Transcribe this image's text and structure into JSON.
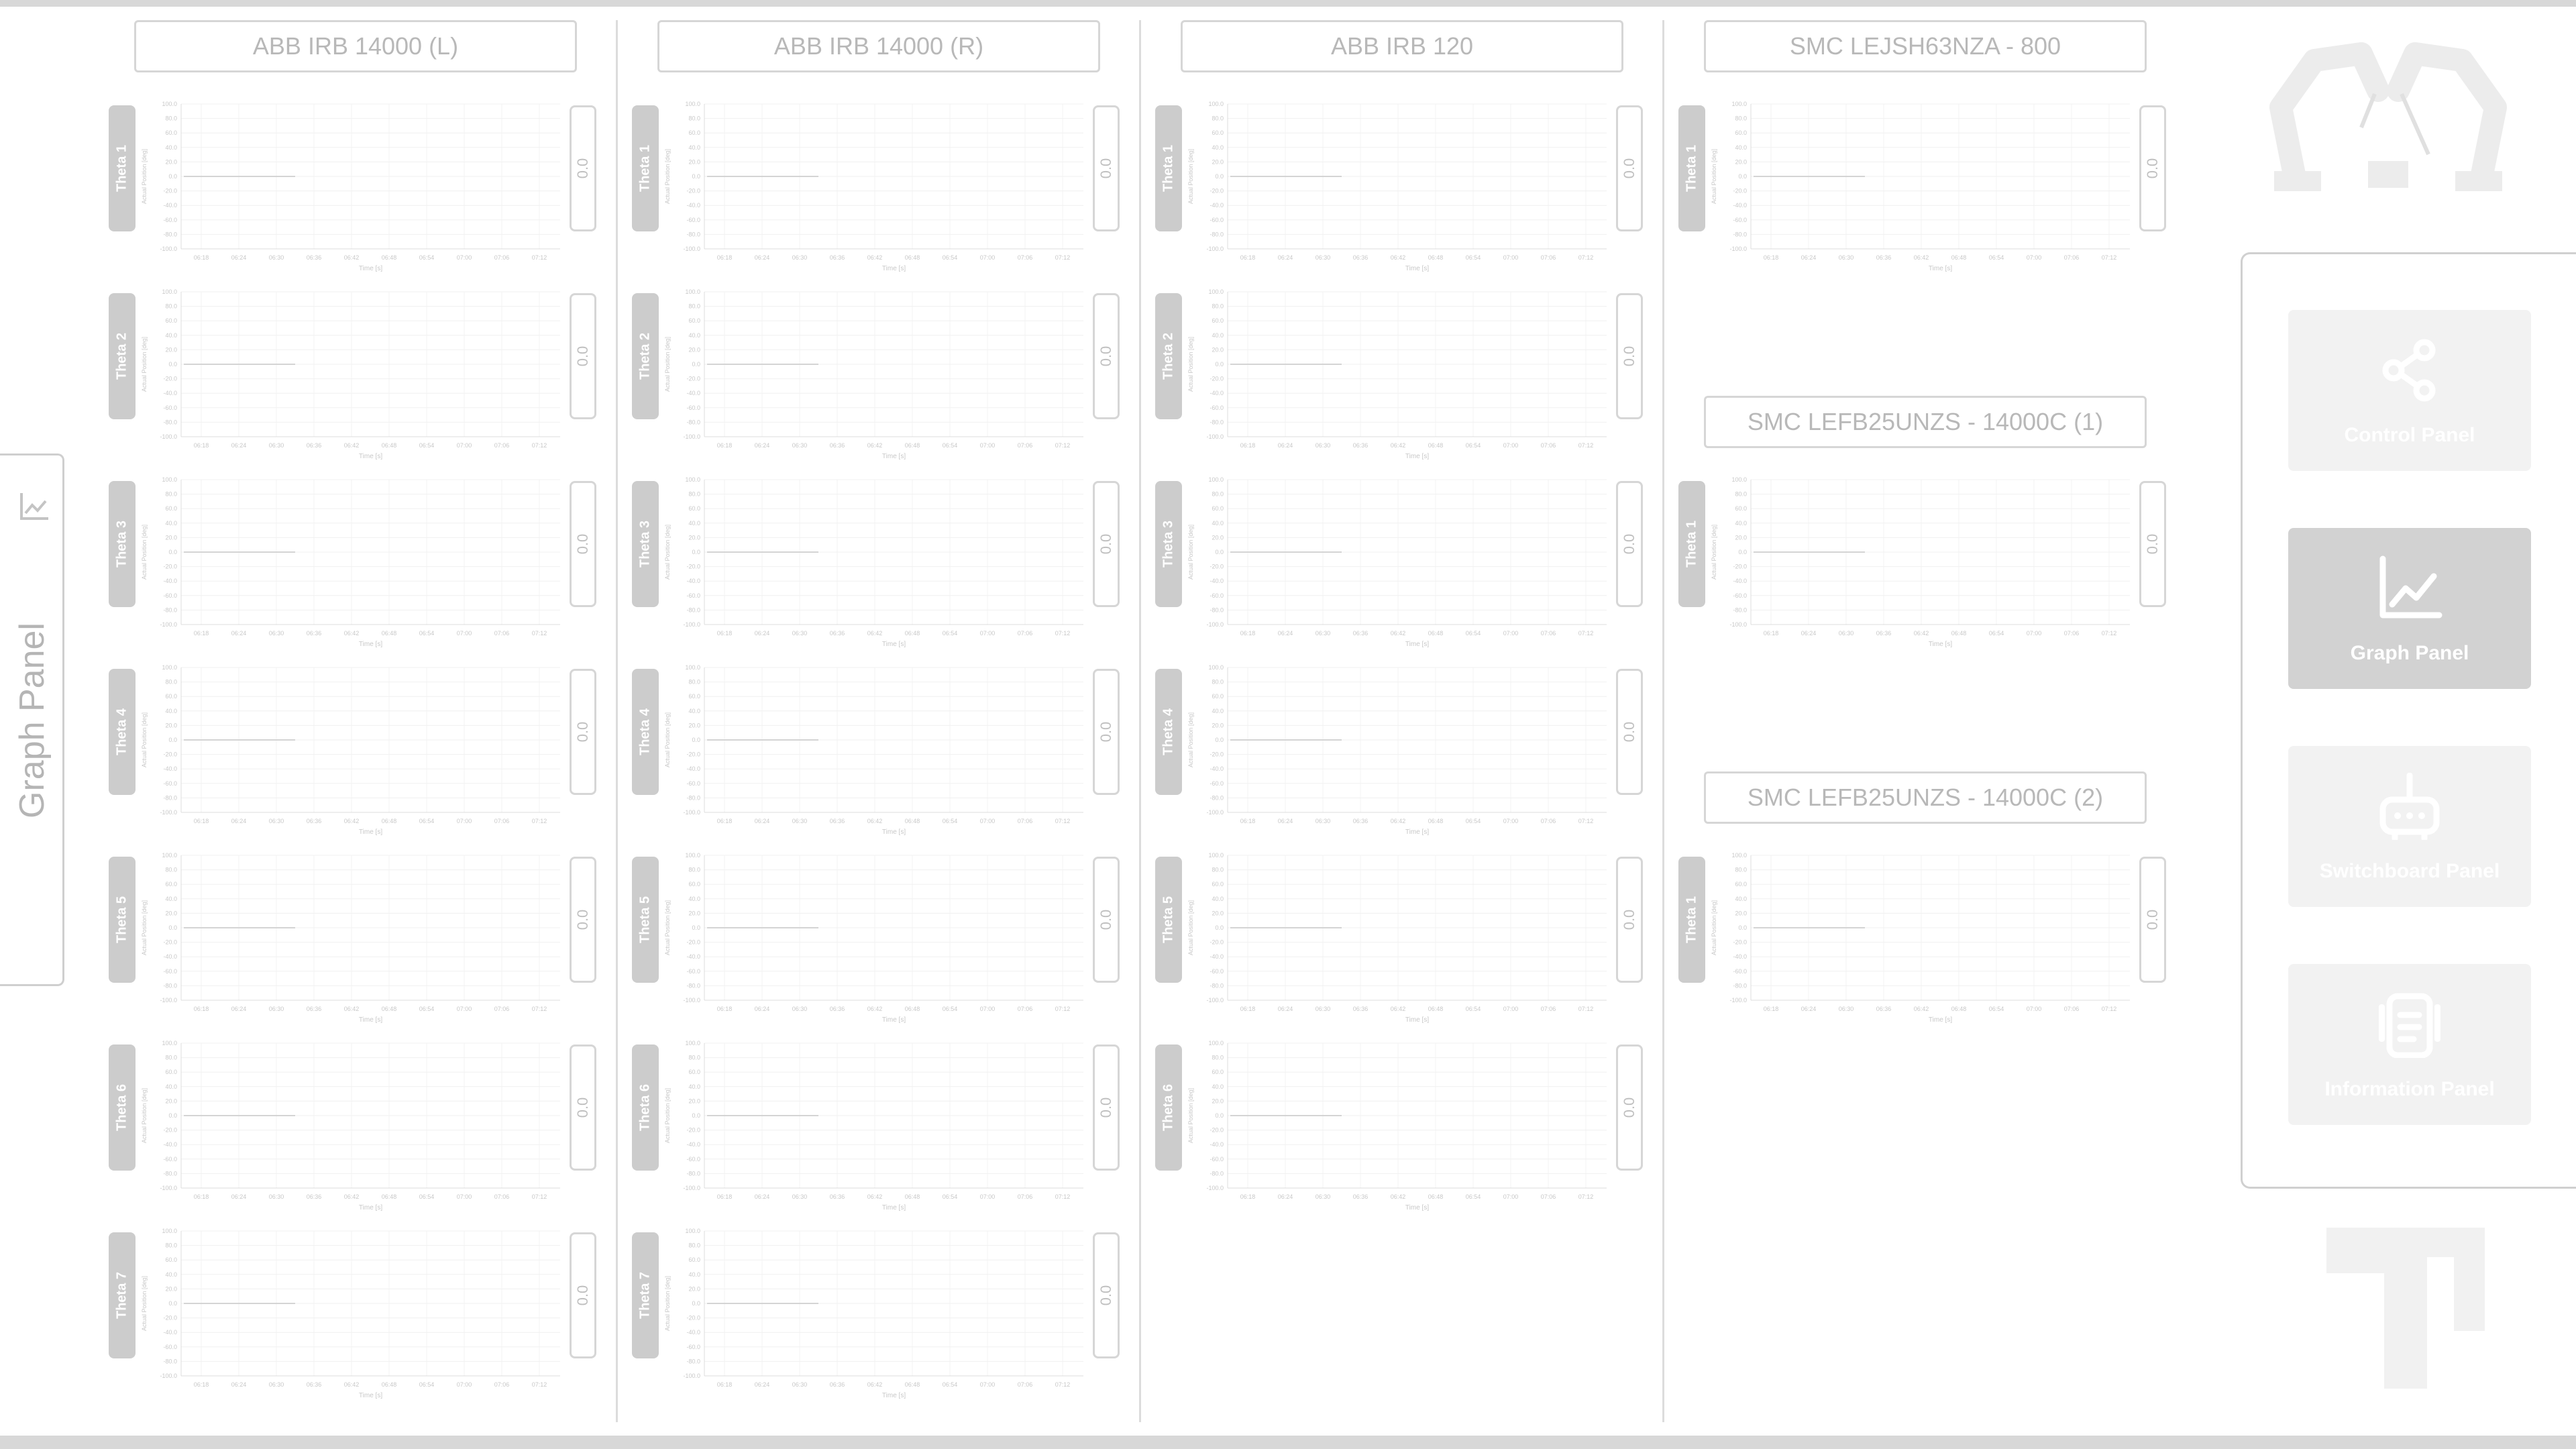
{
  "side_tab": {
    "label": "Graph Panel",
    "icon": "line-chart-icon"
  },
  "columns": [
    {
      "header": "ABB IRB 14000 (L)",
      "charts": [
        {
          "label": "Theta 1",
          "value": "0.0"
        },
        {
          "label": "Theta 2",
          "value": "0.0"
        },
        {
          "label": "Theta 3",
          "value": "0.0"
        },
        {
          "label": "Theta 4",
          "value": "0.0"
        },
        {
          "label": "Theta 5",
          "value": "0.0"
        },
        {
          "label": "Theta 6",
          "value": "0.0"
        },
        {
          "label": "Theta 7",
          "value": "0.0"
        }
      ]
    },
    {
      "header": "ABB IRB 14000 (R)",
      "charts": [
        {
          "label": "Theta 1",
          "value": "0.0"
        },
        {
          "label": "Theta 2",
          "value": "0.0"
        },
        {
          "label": "Theta 3",
          "value": "0.0"
        },
        {
          "label": "Theta 4",
          "value": "0.0"
        },
        {
          "label": "Theta 5",
          "value": "0.0"
        },
        {
          "label": "Theta 6",
          "value": "0.0"
        },
        {
          "label": "Theta 7",
          "value": "0.0"
        }
      ]
    },
    {
      "header": "ABB IRB 120",
      "charts": [
        {
          "label": "Theta 1",
          "value": "0.0"
        },
        {
          "label": "Theta 2",
          "value": "0.0"
        },
        {
          "label": "Theta 3",
          "value": "0.0"
        },
        {
          "label": "Theta 4",
          "value": "0.0"
        },
        {
          "label": "Theta 5",
          "value": "0.0"
        },
        {
          "label": "Theta 6",
          "value": "0.0"
        }
      ]
    }
  ],
  "smc": [
    {
      "header": "SMC LEJSH63NZA - 800",
      "charts": [
        {
          "label": "Theta 1",
          "value": "0.0"
        }
      ]
    },
    {
      "header": "SMC LEFB25UNZS - 14000C (1)",
      "charts": [
        {
          "label": "Theta 1",
          "value": "0.0"
        }
      ]
    },
    {
      "header": "SMC LEFB25UNZS - 14000C (2)",
      "charts": [
        {
          "label": "Theta 1",
          "value": "0.0"
        }
      ]
    }
  ],
  "chart_template": {
    "y_ticks": [
      "100.0",
      "80.0",
      "60.0",
      "40.0",
      "20.0",
      "0.0",
      "-20.0",
      "-40.0",
      "-60.0",
      "-80.0",
      "-100.0"
    ],
    "x_ticks": [
      "06:18",
      "06:24",
      "06:30",
      "06:36",
      "06:42",
      "06:48",
      "06:54",
      "07:00",
      "07:06",
      "07:12"
    ],
    "xlabel": "Time [s]",
    "ylabel": "Actual Position [deg]"
  },
  "chart_data": {
    "type": "line",
    "xlabel": "Time [s]",
    "ylabel": "Actual Position [deg]",
    "ylim": [
      -100,
      100
    ],
    "x_ticks": [
      "06:18",
      "06:24",
      "06:30",
      "06:36",
      "06:42",
      "06:48",
      "06:54",
      "07:00",
      "07:06",
      "07:12"
    ],
    "series": [
      {
        "x": [
          "06:15",
          "06:33"
        ],
        "values": [
          0,
          0
        ]
      }
    ],
    "grid": true
  },
  "nav": [
    {
      "label": "Control Panel",
      "icon": "share-nodes-icon",
      "active": false
    },
    {
      "label": "Graph Panel",
      "icon": "line-chart-icon",
      "active": true
    },
    {
      "label": "Switchboard Panel",
      "icon": "router-icon",
      "active": false
    },
    {
      "label": "Information Panel",
      "icon": "clipboard-icon",
      "active": false
    }
  ],
  "colors": {
    "accent": "#d2d2d2",
    "line": "#d9d9d9",
    "text": "#b5b5b5"
  }
}
